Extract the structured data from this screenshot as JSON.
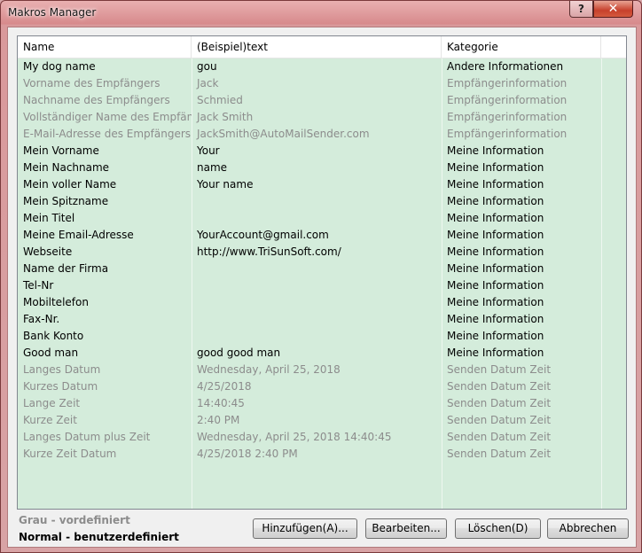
{
  "window": {
    "title": "Makros Manager",
    "help_glyph": "?",
    "close_glyph": "✕"
  },
  "columns": [
    "Name",
    "(Beispiel)text",
    "Kategorie"
  ],
  "rows": [
    {
      "name": "My dog name",
      "text": "gou",
      "category": "Andere Informationen",
      "style": "normal"
    },
    {
      "name": "Vorname des Empfängers",
      "text": "Jack",
      "category": "Empfängerinformation",
      "style": "gray"
    },
    {
      "name": "Nachname des Empfängers",
      "text": "Schmied",
      "category": "Empfängerinformation",
      "style": "gray"
    },
    {
      "name": "Vollständiger Name des Empfäng...",
      "text": "Jack Smith",
      "category": "Empfängerinformation",
      "style": "gray"
    },
    {
      "name": "E-Mail-Adresse des Empfängers",
      "text": "JackSmith@AutoMailSender.com",
      "category": "Empfängerinformation",
      "style": "gray"
    },
    {
      "name": "Mein Vorname",
      "text": "Your",
      "category": "Meine Information",
      "style": "normal"
    },
    {
      "name": "Mein Nachname",
      "text": "name",
      "category": "Meine Information",
      "style": "normal"
    },
    {
      "name": "Mein voller Name",
      "text": "Your name",
      "category": "Meine Information",
      "style": "normal"
    },
    {
      "name": "Mein Spitzname",
      "text": "",
      "category": "Meine Information",
      "style": "normal"
    },
    {
      "name": "Mein Titel",
      "text": "",
      "category": "Meine Information",
      "style": "normal"
    },
    {
      "name": "Meine Email-Adresse",
      "text": "YourAccount@gmail.com",
      "category": "Meine Information",
      "style": "normal"
    },
    {
      "name": "Webseite",
      "text": "http://www.TriSunSoft.com/",
      "category": "Meine Information",
      "style": "normal"
    },
    {
      "name": "Name der Firma",
      "text": "",
      "category": "Meine Information",
      "style": "normal"
    },
    {
      "name": "Tel-Nr",
      "text": "",
      "category": "Meine Information",
      "style": "normal"
    },
    {
      "name": "Mobiltelefon",
      "text": "",
      "category": "Meine Information",
      "style": "normal"
    },
    {
      "name": "Fax-Nr.",
      "text": "",
      "category": "Meine Information",
      "style": "normal"
    },
    {
      "name": "Bank Konto",
      "text": "",
      "category": "Meine Information",
      "style": "normal"
    },
    {
      "name": "Good man",
      "text": "good good man",
      "category": "Meine Information",
      "style": "normal"
    },
    {
      "name": "Langes Datum",
      "text": "Wednesday, April 25, 2018",
      "category": "Senden Datum Zeit",
      "style": "gray"
    },
    {
      "name": "Kurzes Datum",
      "text": "4/25/2018",
      "category": "Senden Datum Zeit",
      "style": "gray"
    },
    {
      "name": "Lange Zeit",
      "text": "14:40:45",
      "category": "Senden Datum Zeit",
      "style": "gray"
    },
    {
      "name": "Kurze Zeit",
      "text": "2:40 PM",
      "category": "Senden Datum Zeit",
      "style": "gray"
    },
    {
      "name": "Langes Datum plus Zeit",
      "text": "Wednesday, April 25, 2018 14:40:45",
      "category": "Senden Datum Zeit",
      "style": "gray"
    },
    {
      "name": "Kurze Zeit Datum",
      "text": "4/25/2018 2:40 PM",
      "category": "Senden Datum Zeit",
      "style": "gray"
    }
  ],
  "legend": {
    "gray": "Grau - vordefiniert",
    "normal": "Normal - benutzerdefiniert"
  },
  "buttons": {
    "add": "Hinzufügen(A)...",
    "edit": "Bearbeiten...",
    "delete": "Löschen(D)",
    "cancel": "Abbrechen"
  },
  "colors": {
    "row_background": "#d4ecdb",
    "gray_text": "#8c8c8c",
    "title_bar": "#d78a8c"
  }
}
